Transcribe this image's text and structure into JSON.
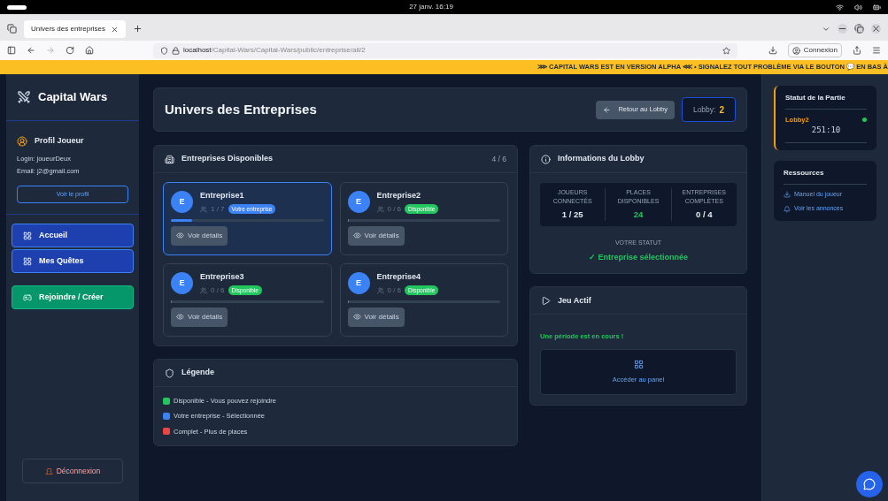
{
  "os_bar": {
    "clock": "27 janv.  16:19"
  },
  "browser": {
    "tab": {
      "title": "Univers des entreprises",
      "selected": true
    },
    "url_host": "localhost",
    "url_path": "/Capital-Wars/Capital-Wars/public/entreprise/all/2",
    "account": "Connexion"
  },
  "banner": "⋙ CAPITAL WARS EST EN VERSION ALPHA ⋘  •  SIGNALEZ TOUT PROBLÈME VIA LE BOUTON 💬 EN BAS À",
  "sidebar": {
    "brand": "Capital Wars",
    "profile_title": "Profil Joueur",
    "login_label": "Login:",
    "login": "joueurDeux",
    "email_label": "Email:",
    "email": "j2@gmail.com",
    "profile_button": "Voir le profil",
    "nav": [
      {
        "label": "Accueil",
        "kind": "nav"
      },
      {
        "label": "Mes Quêtes",
        "kind": "nav"
      },
      {
        "label": "Rejoindre / Créer",
        "kind": "action"
      }
    ],
    "logout": "Déconnexion"
  },
  "header": {
    "title": "Univers des Entreprises",
    "back_button": "Retour au Lobby",
    "lobby_label": "Lobby:",
    "lobby_value": "2"
  },
  "companies": {
    "title": "Entreprises Disponibles",
    "count": "4 / 6",
    "items": [
      {
        "initial": "E",
        "name": "Entreprise1",
        "members": "1 / 7",
        "badge": "Votre entreprise",
        "kind": "mine",
        "selected": true,
        "level": 0.14,
        "button": "Voir détails"
      },
      {
        "initial": "E",
        "name": "Entreprise2",
        "members": "0 / 6",
        "badge": "Disponible",
        "kind": "available",
        "selected": false,
        "level": 0,
        "button": "Voir détails"
      },
      {
        "initial": "E",
        "name": "Entreprise3",
        "members": "0 / 6",
        "badge": "Disponible",
        "kind": "available",
        "selected": false,
        "level": 0,
        "button": "Voir détails"
      },
      {
        "initial": "E",
        "name": "Entreprise4",
        "members": "0 / 6",
        "badge": "Disponible",
        "kind": "available",
        "selected": false,
        "level": 0,
        "button": "Voir détails"
      }
    ]
  },
  "legend": {
    "title": "Légende",
    "items": [
      {
        "label": "Disponible - Vous pouvez rejoindre",
        "color": "#22c55e"
      },
      {
        "label": "Votre entreprise - Sélectionnée",
        "color": "#3b82f6"
      },
      {
        "label": "Complet - Plus de places",
        "color": "#ef4444"
      }
    ]
  },
  "lobby_info": {
    "title": "Informations du Lobby",
    "stats": [
      {
        "label": "JOUEURS CONNECTÉS",
        "value": "1 / 25",
        "kind": "plain"
      },
      {
        "label": "PLACES DISPONIBLES",
        "value": "24",
        "kind": "good"
      },
      {
        "label": "ENTREPRISES COMPLÈTES",
        "value": "0 / 4",
        "kind": "plain"
      }
    ],
    "status_label": "VOTRE STATUT",
    "status": "✓ Entreprise sélectionnée"
  },
  "active_game": {
    "title": "Jeu Actif",
    "message": "Une période est en cours !",
    "panel_link": "Accéder au panel"
  },
  "game_status": {
    "title": "Statut de la Partie",
    "lobby": "Lobby2",
    "online": true,
    "timer": "251:10"
  },
  "resources": {
    "title": "Ressources",
    "links": [
      {
        "label": "Manuel du joueur",
        "kind": "download"
      },
      {
        "label": "Voir les annonces",
        "kind": "bell"
      }
    ]
  }
}
